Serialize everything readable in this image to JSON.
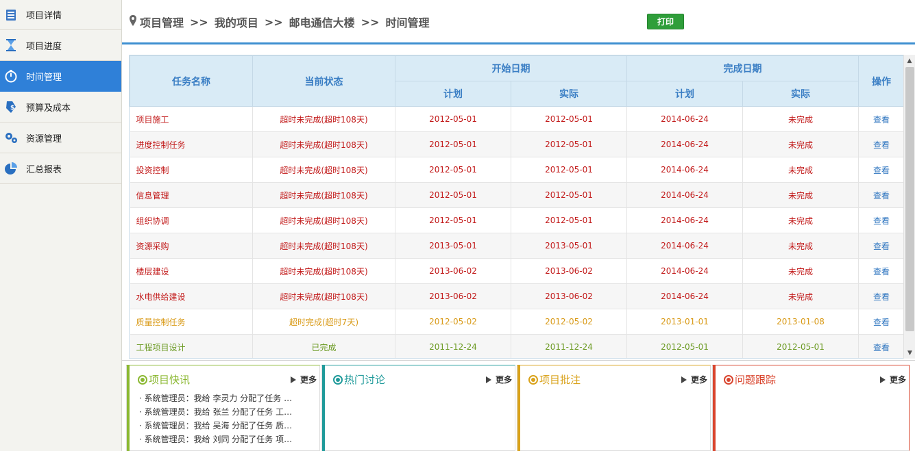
{
  "sidebar": {
    "items": [
      {
        "label": "项目详情",
        "icon": "document-list-icon",
        "active": false
      },
      {
        "label": "项目进度",
        "icon": "hourglass-icon",
        "active": false
      },
      {
        "label": "时间管理",
        "icon": "stopwatch-icon",
        "active": true
      },
      {
        "label": "预算及成本",
        "icon": "price-tag-icon",
        "active": false
      },
      {
        "label": "资源管理",
        "icon": "gears-icon",
        "active": false
      },
      {
        "label": "汇总报表",
        "icon": "pie-chart-icon",
        "active": false
      }
    ]
  },
  "header": {
    "breadcrumb": [
      "项目管理",
      "我的项目",
      "邮电通信大楼",
      "时间管理"
    ],
    "separator": ">>",
    "print_label": "打印"
  },
  "table": {
    "headers": {
      "task_name": "任务名称",
      "status": "当前状态",
      "start_date": "开始日期",
      "end_date": "完成日期",
      "planned": "计划",
      "actual": "实际",
      "action": "操作"
    },
    "rows": [
      {
        "name": "项目施工",
        "status": "超时未完成(超时108天)",
        "start_plan": "2012-05-01",
        "start_actual": "2012-05-01",
        "end_plan": "2014-06-24",
        "end_actual": "未完成",
        "action": "查看",
        "state": "red"
      },
      {
        "name": "进度控制任务",
        "status": "超时未完成(超时108天)",
        "start_plan": "2012-05-01",
        "start_actual": "2012-05-01",
        "end_plan": "2014-06-24",
        "end_actual": "未完成",
        "action": "查看",
        "state": "red"
      },
      {
        "name": "投资控制",
        "status": "超时未完成(超时108天)",
        "start_plan": "2012-05-01",
        "start_actual": "2012-05-01",
        "end_plan": "2014-06-24",
        "end_actual": "未完成",
        "action": "查看",
        "state": "red"
      },
      {
        "name": "信息管理",
        "status": "超时未完成(超时108天)",
        "start_plan": "2012-05-01",
        "start_actual": "2012-05-01",
        "end_plan": "2014-06-24",
        "end_actual": "未完成",
        "action": "查看",
        "state": "red"
      },
      {
        "name": "组织协调",
        "status": "超时未完成(超时108天)",
        "start_plan": "2012-05-01",
        "start_actual": "2012-05-01",
        "end_plan": "2014-06-24",
        "end_actual": "未完成",
        "action": "查看",
        "state": "red"
      },
      {
        "name": "资源采购",
        "status": "超时未完成(超时108天)",
        "start_plan": "2013-05-01",
        "start_actual": "2013-05-01",
        "end_plan": "2014-06-24",
        "end_actual": "未完成",
        "action": "查看",
        "state": "red"
      },
      {
        "name": "楼层建设",
        "status": "超时未完成(超时108天)",
        "start_plan": "2013-06-02",
        "start_actual": "2013-06-02",
        "end_plan": "2014-06-24",
        "end_actual": "未完成",
        "action": "查看",
        "state": "red"
      },
      {
        "name": "水电供给建设",
        "status": "超时未完成(超时108天)",
        "start_plan": "2013-06-02",
        "start_actual": "2013-06-02",
        "end_plan": "2014-06-24",
        "end_actual": "未完成",
        "action": "查看",
        "state": "red"
      },
      {
        "name": "质量控制任务",
        "status": "超时完成(超时7天)",
        "start_plan": "2012-05-02",
        "start_actual": "2012-05-02",
        "end_plan": "2013-01-01",
        "end_actual": "2013-01-08",
        "action": "查看",
        "state": "orange"
      },
      {
        "name": "工程项目设计",
        "status": "已完成",
        "start_plan": "2011-12-24",
        "start_actual": "2011-12-24",
        "end_plan": "2012-05-01",
        "end_actual": "2012-05-01",
        "action": "查看",
        "state": "green"
      }
    ]
  },
  "panels": [
    {
      "title": "项目快讯",
      "color": "#8bb832",
      "more": "更多",
      "items": [
        "系统管理员：我给 李灵力 分配了任务 …",
        "系统管理员：我给 张兰 分配了任务 工…",
        "系统管理员：我给 吴海 分配了任务 质…",
        "系统管理员：我给 刘同 分配了任务 项…"
      ]
    },
    {
      "title": "热门讨论",
      "color": "#1f9a9a",
      "more": "更多",
      "items": []
    },
    {
      "title": "项目批注",
      "color": "#d9a21a",
      "more": "更多",
      "items": []
    },
    {
      "title": "问题跟踪",
      "color": "#d9452e",
      "more": "更多",
      "items": []
    }
  ],
  "colors": {
    "accent": "#2f80d8",
    "header_line": "#3d8fd0",
    "status_red": "#c21a1a",
    "status_orange": "#d99a17",
    "status_green": "#6b9a22",
    "print_button": "#2f9e3a"
  }
}
